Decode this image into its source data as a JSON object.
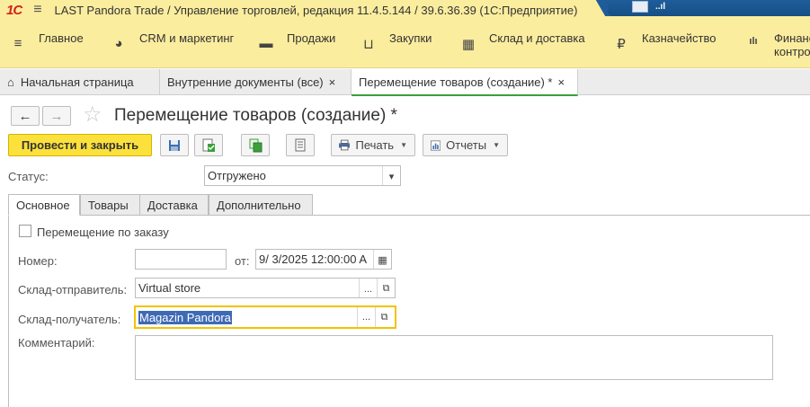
{
  "window": {
    "logo": "1С",
    "title": "LAST Pandora Trade / Управление торговлей, редакция 11.4.5.144 / 39.6.36.39  (1С:Предприятие)",
    "signal": "..ıl"
  },
  "menu": {
    "items": [
      {
        "label": "Главное",
        "icon": "hamburger-icon",
        "glyph": "≡"
      },
      {
        "label": "CRM и маркетинг",
        "icon": "pie-chart-icon",
        "glyph": "◕"
      },
      {
        "label": "Продажи",
        "icon": "bag-icon",
        "glyph": "👜"
      },
      {
        "label": "Закупки",
        "icon": "cart-icon",
        "glyph": "🛒"
      },
      {
        "label": "Склад и доставка",
        "icon": "warehouse-icon",
        "glyph": "▦"
      },
      {
        "label": "Казначейство",
        "icon": "coin-icon",
        "glyph": "₽"
      },
      {
        "label": "Финансовый\nконтроль",
        "line1": "Финансовый",
        "line2": "контроль",
        "icon": "bar-chart-icon",
        "glyph": "ılı"
      }
    ]
  },
  "tabs": {
    "home": "Начальная страница",
    "internal_docs": "Внутренние документы (все)",
    "current": "Перемещение товаров (создание) *",
    "close": "×"
  },
  "header": {
    "back": "←",
    "forward": "→",
    "star": "☆",
    "title": "Перемещение товаров (создание) *"
  },
  "toolbar": {
    "post_and_close": "Провести и закрыть",
    "print": "Печать",
    "reports": "Отчеты"
  },
  "status": {
    "label": "Статус:",
    "value": "Отгружено"
  },
  "form_tabs": [
    "Основное",
    "Товары",
    "Доставка",
    "Дополнительно"
  ],
  "form": {
    "by_order_label": "Перемещение по заказу",
    "by_order_checked": false,
    "number_label": "Номер:",
    "number_value": "",
    "date_from_label": "от:",
    "date_value": "9/ 3/2025 12:00:00 A",
    "sender_label": "Склад-отправитель:",
    "sender_value": "Virtual store",
    "receiver_label": "Склад-получатель:",
    "receiver_value": "Magazin Pandora",
    "comment_label": "Комментарий:",
    "comment_value": "",
    "select_btn": "...",
    "open_btn": "⧉"
  },
  "colors": {
    "menu_bg": "#fbed9e",
    "primary_button": "#fce13c",
    "active_tab_underline": "#3c9f3c",
    "focus_border": "#f2c300",
    "selection": "#3e6ab5"
  }
}
